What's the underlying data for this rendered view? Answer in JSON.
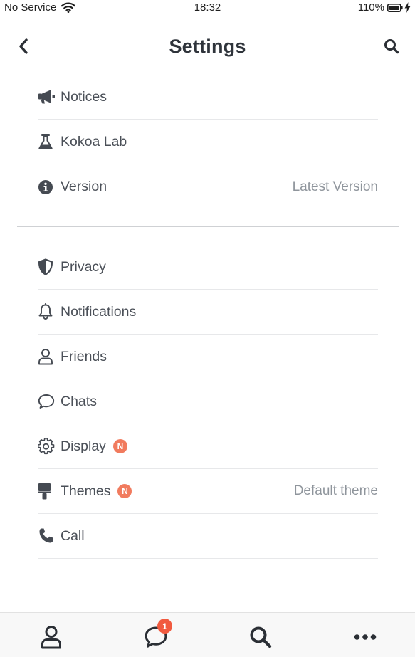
{
  "status_bar": {
    "carrier": "No Service",
    "time": "18:32",
    "battery": "110%"
  },
  "header": {
    "title": "Settings"
  },
  "sections": [
    [
      {
        "id": "notices",
        "label": "Notices",
        "icon": "megaphone-icon"
      },
      {
        "id": "kokoa-lab",
        "label": "Kokoa Lab",
        "icon": "flask-icon"
      },
      {
        "id": "version",
        "label": "Version",
        "icon": "info-icon",
        "value": "Latest Version"
      }
    ],
    [
      {
        "id": "privacy",
        "label": "Privacy",
        "icon": "shield-icon"
      },
      {
        "id": "notifications",
        "label": "Notifications",
        "icon": "bell-icon"
      },
      {
        "id": "friends",
        "label": "Friends",
        "icon": "user-icon"
      },
      {
        "id": "chats",
        "label": "Chats",
        "icon": "chat-bubble-icon"
      },
      {
        "id": "display",
        "label": "Display",
        "icon": "gear-icon",
        "badge": "N"
      },
      {
        "id": "themes",
        "label": "Themes",
        "icon": "paint-roller-icon",
        "badge": "N",
        "value": "Default theme"
      },
      {
        "id": "call",
        "label": "Call",
        "icon": "phone-icon"
      }
    ]
  ],
  "bottom_nav": {
    "chats_badge": "1",
    "items": [
      "friends-tab",
      "chats-tab",
      "search-tab",
      "more-tab"
    ]
  },
  "colors": {
    "accent_badge": "#f17b5e",
    "nav_badge": "#f15a3f",
    "text": "#4b5058",
    "secondary_text": "#8f959c"
  }
}
